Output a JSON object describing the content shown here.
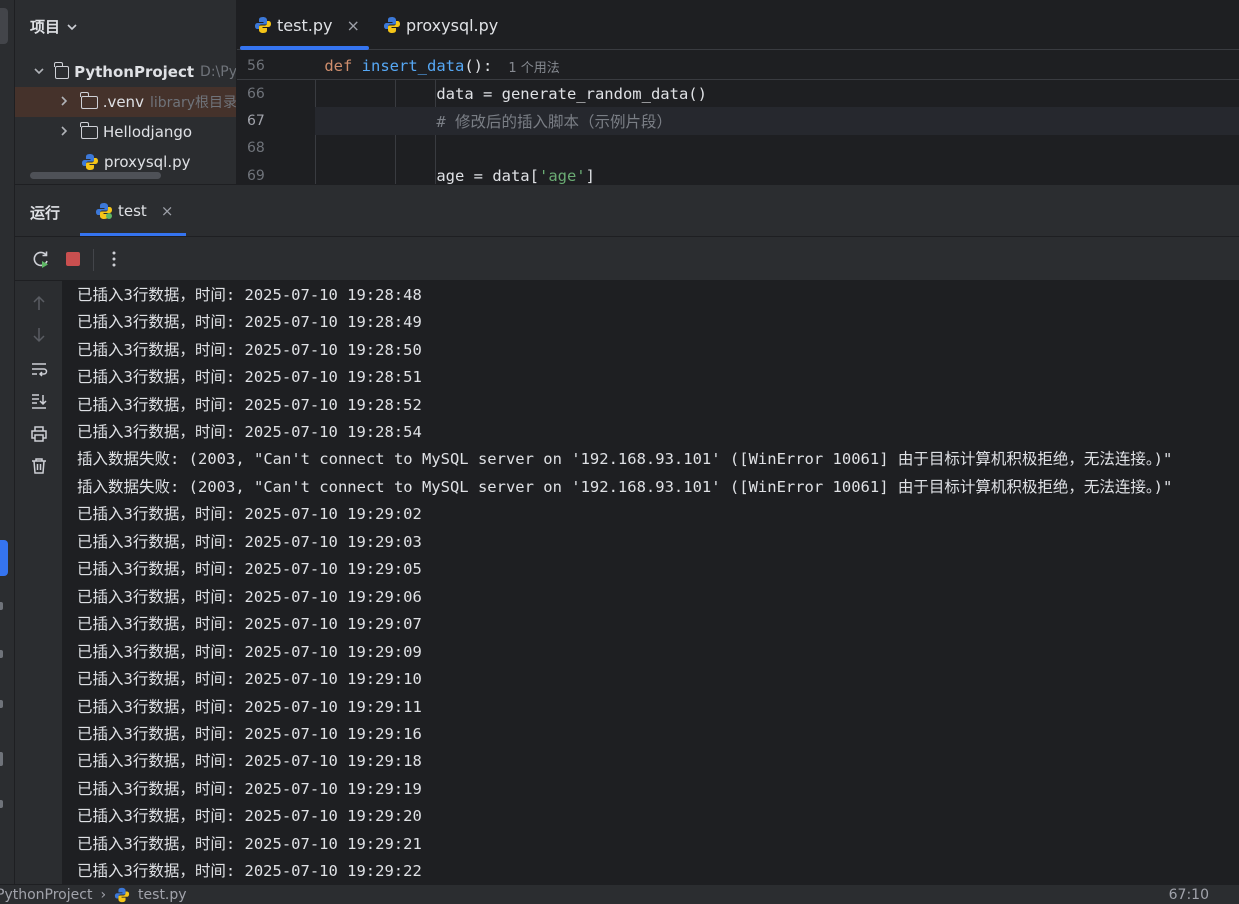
{
  "project_panel": {
    "title": "项目",
    "tree": [
      {
        "name": "PythonProject",
        "hint": "D:\\Py"
      },
      {
        "name": ".venv",
        "hint": "library根目录"
      },
      {
        "name": "Hellodjango",
        "hint": ""
      },
      {
        "name": "proxysql.py",
        "hint": ""
      }
    ]
  },
  "editor": {
    "tabs": [
      {
        "label": "test.py",
        "close": "×"
      },
      {
        "label": "proxysql.py"
      }
    ],
    "lines": [
      {
        "num": "56",
        "tokens": [
          {
            "t": "def ",
            "c": "kw"
          },
          {
            "t": "insert_data",
            "c": "fn"
          },
          {
            "t": "():",
            "c": ""
          }
        ],
        "usage": "1 个用法"
      },
      {
        "num": "66",
        "tokens": [
          {
            "t": "            data = generate_random_data()",
            "c": ""
          }
        ]
      },
      {
        "num": "67",
        "tokens": [
          {
            "t": "            # 修改后的插入脚本（示例片段）",
            "c": "cm"
          }
        ]
      },
      {
        "num": "68",
        "tokens": []
      },
      {
        "num": "69",
        "tokens": [
          {
            "t": "            age = data[",
            "c": ""
          },
          {
            "t": "'age'",
            "c": "str"
          },
          {
            "t": "]",
            "c": ""
          }
        ]
      }
    ]
  },
  "run_panel": {
    "title": "运行",
    "tab_label": "test",
    "tab_close": "×",
    "console_lines": [
      "已插入3行数据，时间: 2025-07-10 19:28:48",
      "已插入3行数据，时间: 2025-07-10 19:28:49",
      "已插入3行数据，时间: 2025-07-10 19:28:50",
      "已插入3行数据，时间: 2025-07-10 19:28:51",
      "已插入3行数据，时间: 2025-07-10 19:28:52",
      "已插入3行数据，时间: 2025-07-10 19:28:54",
      "插入数据失败: (2003, \"Can't connect to MySQL server on '192.168.93.101' ([WinError 10061] 由于目标计算机积极拒绝，无法连接。)\"",
      "插入数据失败: (2003, \"Can't connect to MySQL server on '192.168.93.101' ([WinError 10061] 由于目标计算机积极拒绝，无法连接。)\"",
      "已插入3行数据，时间: 2025-07-10 19:29:02",
      "已插入3行数据，时间: 2025-07-10 19:29:03",
      "已插入3行数据，时间: 2025-07-10 19:29:05",
      "已插入3行数据，时间: 2025-07-10 19:29:06",
      "已插入3行数据，时间: 2025-07-10 19:29:07",
      "已插入3行数据，时间: 2025-07-10 19:29:09",
      "已插入3行数据，时间: 2025-07-10 19:29:10",
      "已插入3行数据，时间: 2025-07-10 19:29:11",
      "已插入3行数据，时间: 2025-07-10 19:29:16",
      "已插入3行数据，时间: 2025-07-10 19:29:18",
      "已插入3行数据，时间: 2025-07-10 19:29:19",
      "已插入3行数据，时间: 2025-07-10 19:29:20",
      "已插入3行数据，时间: 2025-07-10 19:29:21",
      "已插入3行数据，时间: 2025-07-10 19:29:22"
    ]
  },
  "status_bar": {
    "project": "PythonProject",
    "separator": "›",
    "file": "test.py",
    "position": "67:10"
  },
  "colors": {
    "accent": "#3574f0",
    "stop_button": "#c94f4f",
    "rerun_badge": "#5fb865"
  },
  "icons": [
    "rerun-icon",
    "stop-icon",
    "more-icon",
    "scroll-up-icon",
    "scroll-down-icon",
    "soft-wrap-icon",
    "scroll-to-end-icon",
    "print-icon",
    "trash-icon",
    "python-file-icon",
    "folder-icon"
  ]
}
